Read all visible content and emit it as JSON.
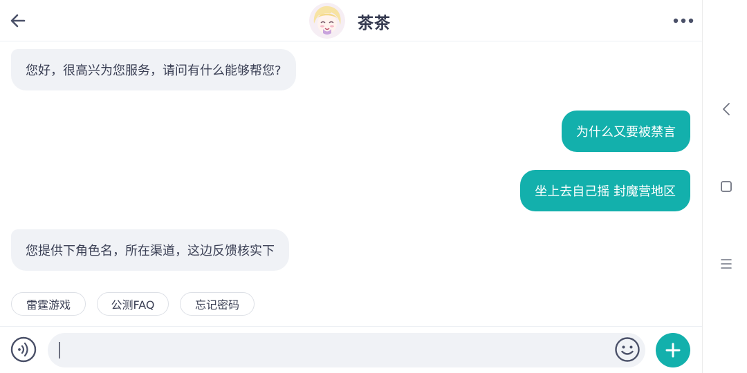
{
  "header": {
    "title": "茶茶",
    "back_icon": "arrow-left-icon",
    "more_icon": "more-dots-icon",
    "avatar_icon": "anime-girl-avatar"
  },
  "messages": [
    {
      "side": "in",
      "text": "您好，很高兴为您服务，请问有什么能够帮您?"
    },
    {
      "side": "out",
      "text": "为什么又要被禁言"
    },
    {
      "side": "out",
      "text": "坐上去自己摇 封魔营地区"
    },
    {
      "side": "in",
      "text": "您提供下角色名，所在渠道，这边反馈核实下"
    }
  ],
  "quick_replies": [
    "雷霆游戏",
    "公测FAQ",
    "忘记密码"
  ],
  "input": {
    "value": "",
    "voice_icon": "voice-icon",
    "emoji_icon": "smiley-icon",
    "plus_icon": "plus-icon"
  },
  "system_nav": {
    "back_icon": "triangle-back-icon",
    "home_icon": "square-home-icon",
    "menu_icon": "menu-lines-icon"
  },
  "colors": {
    "accent": "#13b0ac",
    "incoming_bubble": "#f0f2f6",
    "text": "#33384e"
  }
}
